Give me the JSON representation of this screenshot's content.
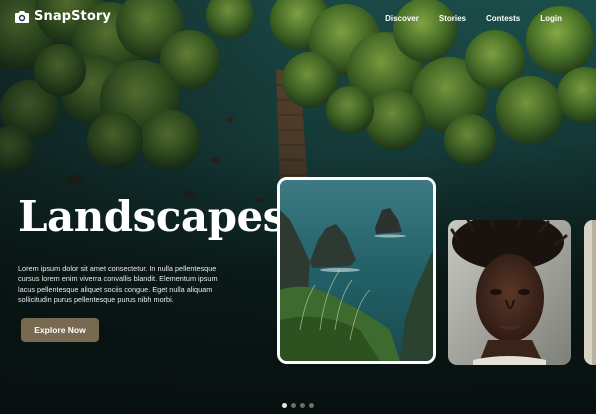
{
  "brand": {
    "name": "SnapStory",
    "icon": "camera-icon"
  },
  "nav": {
    "items": [
      {
        "label": "Discover"
      },
      {
        "label": "Stories"
      },
      {
        "label": "Contests"
      },
      {
        "label": "Login"
      }
    ]
  },
  "hero": {
    "title": "Landscapes",
    "description": "Lorem ipsum dolor sit amet consectetur. In nulla pellentesque cursus lorem enim viverra convallis blandit. Elementum ipsum lacus pellentesque aliquet sociis congue. Eget nulla aliquam sollicitudin purus pellentesque purus nibh morbi.",
    "cta_label": "Explore Now"
  },
  "carousel": {
    "cards": [
      "sea-cliffs-photo",
      "portrait-photo",
      "partial-photo"
    ],
    "active_index": 0,
    "total": 4
  },
  "colors": {
    "accent_button": "#776a50",
    "overlay": "#07100f",
    "active_dot": "#e6e8e7",
    "inactive_dot": "#6a6f6e"
  }
}
